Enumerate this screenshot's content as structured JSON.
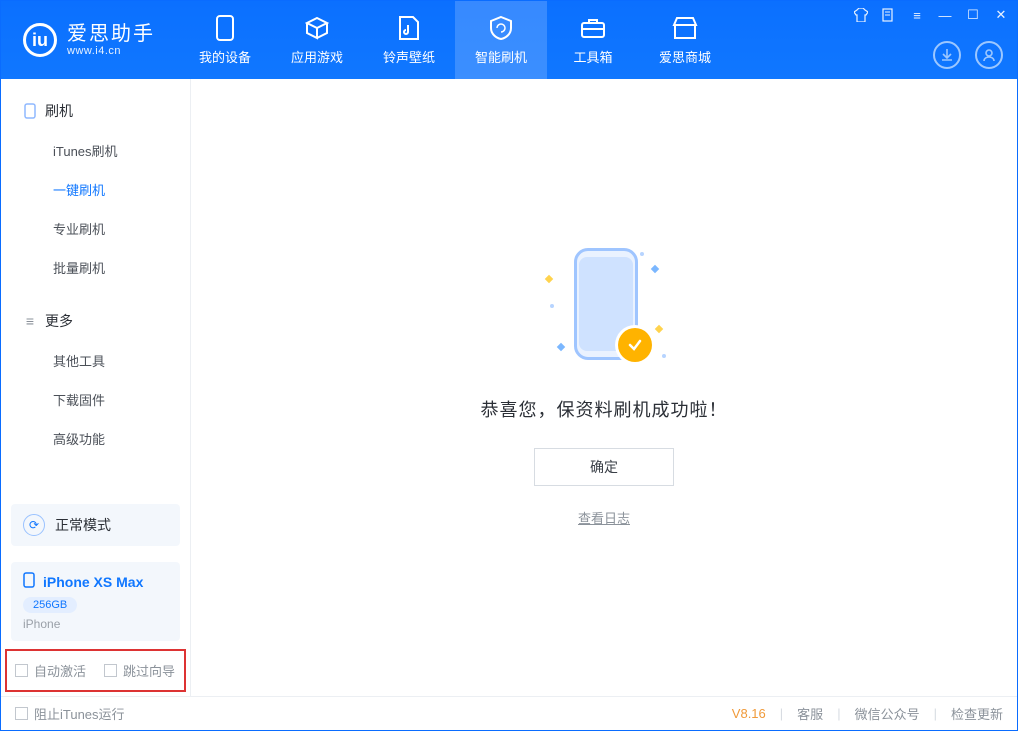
{
  "app": {
    "name": "爱思助手",
    "domain": "www.i4.cn"
  },
  "tabs": [
    {
      "label": "我的设备",
      "icon": "device"
    },
    {
      "label": "应用游戏",
      "icon": "cube"
    },
    {
      "label": "铃声壁纸",
      "icon": "music"
    },
    {
      "label": "智能刷机",
      "icon": "refresh",
      "active": true
    },
    {
      "label": "工具箱",
      "icon": "toolbox"
    },
    {
      "label": "爱思商城",
      "icon": "store"
    }
  ],
  "window_controls": [
    "shirt",
    "book",
    "menu",
    "minimize",
    "maximize",
    "close"
  ],
  "header_actions": [
    "download",
    "user"
  ],
  "sidebar": {
    "group1": {
      "title": "刷机",
      "items": [
        "iTunes刷机",
        "一键刷机",
        "专业刷机",
        "批量刷机"
      ],
      "activeIndex": 1
    },
    "group2": {
      "title": "更多",
      "items": [
        "其他工具",
        "下载固件",
        "高级功能"
      ]
    }
  },
  "mode": {
    "label": "正常模式"
  },
  "device": {
    "name": "iPhone XS Max",
    "capacity": "256GB",
    "type": "iPhone"
  },
  "options": {
    "auto_activate": "自动激活",
    "skip_guide": "跳过向导"
  },
  "main": {
    "success_msg": "恭喜您，保资料刷机成功啦！",
    "ok_btn": "确定",
    "log_link": "查看日志"
  },
  "status": {
    "block_itunes": "阻止iTunes运行",
    "version": "V8.16",
    "links": [
      "客服",
      "微信公众号",
      "检查更新"
    ]
  }
}
